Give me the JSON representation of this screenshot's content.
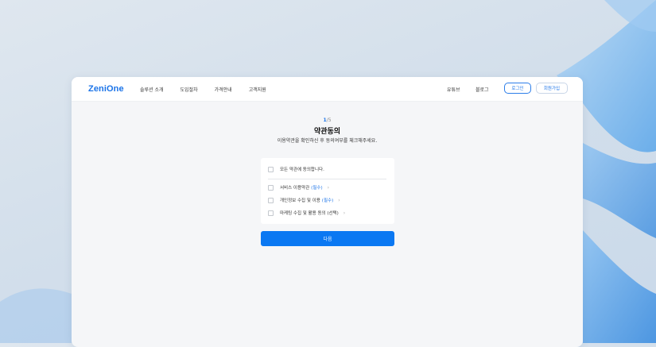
{
  "brand": {
    "logo": "ZeniOne"
  },
  "nav": {
    "links": [
      "솔루션 소개",
      "도입절차",
      "가격안내",
      "고객지원"
    ],
    "right_links": [
      "유튜브",
      "블로그"
    ],
    "login": "로그인",
    "signup": "회원가입"
  },
  "step": {
    "current": "1",
    "total": "/5"
  },
  "page": {
    "title": "약관동의",
    "subtitle": "이용약관을 확인하신 후 동의여부를 체크해주세요."
  },
  "terms": {
    "all": "모든 약관에 동의합니다.",
    "items": [
      {
        "label": "서비스 이용약관",
        "tag": "(필수)"
      },
      {
        "label": "개인정보 수집 및 이용",
        "tag": "(필수)"
      },
      {
        "label": "마케팅 수집 및 활용 동의 (선택)",
        "tag": ""
      }
    ],
    "chevron": "›"
  },
  "next_button": "다음",
  "colors": {
    "accent": "#0b78f2",
    "link": "#1a73e8"
  }
}
